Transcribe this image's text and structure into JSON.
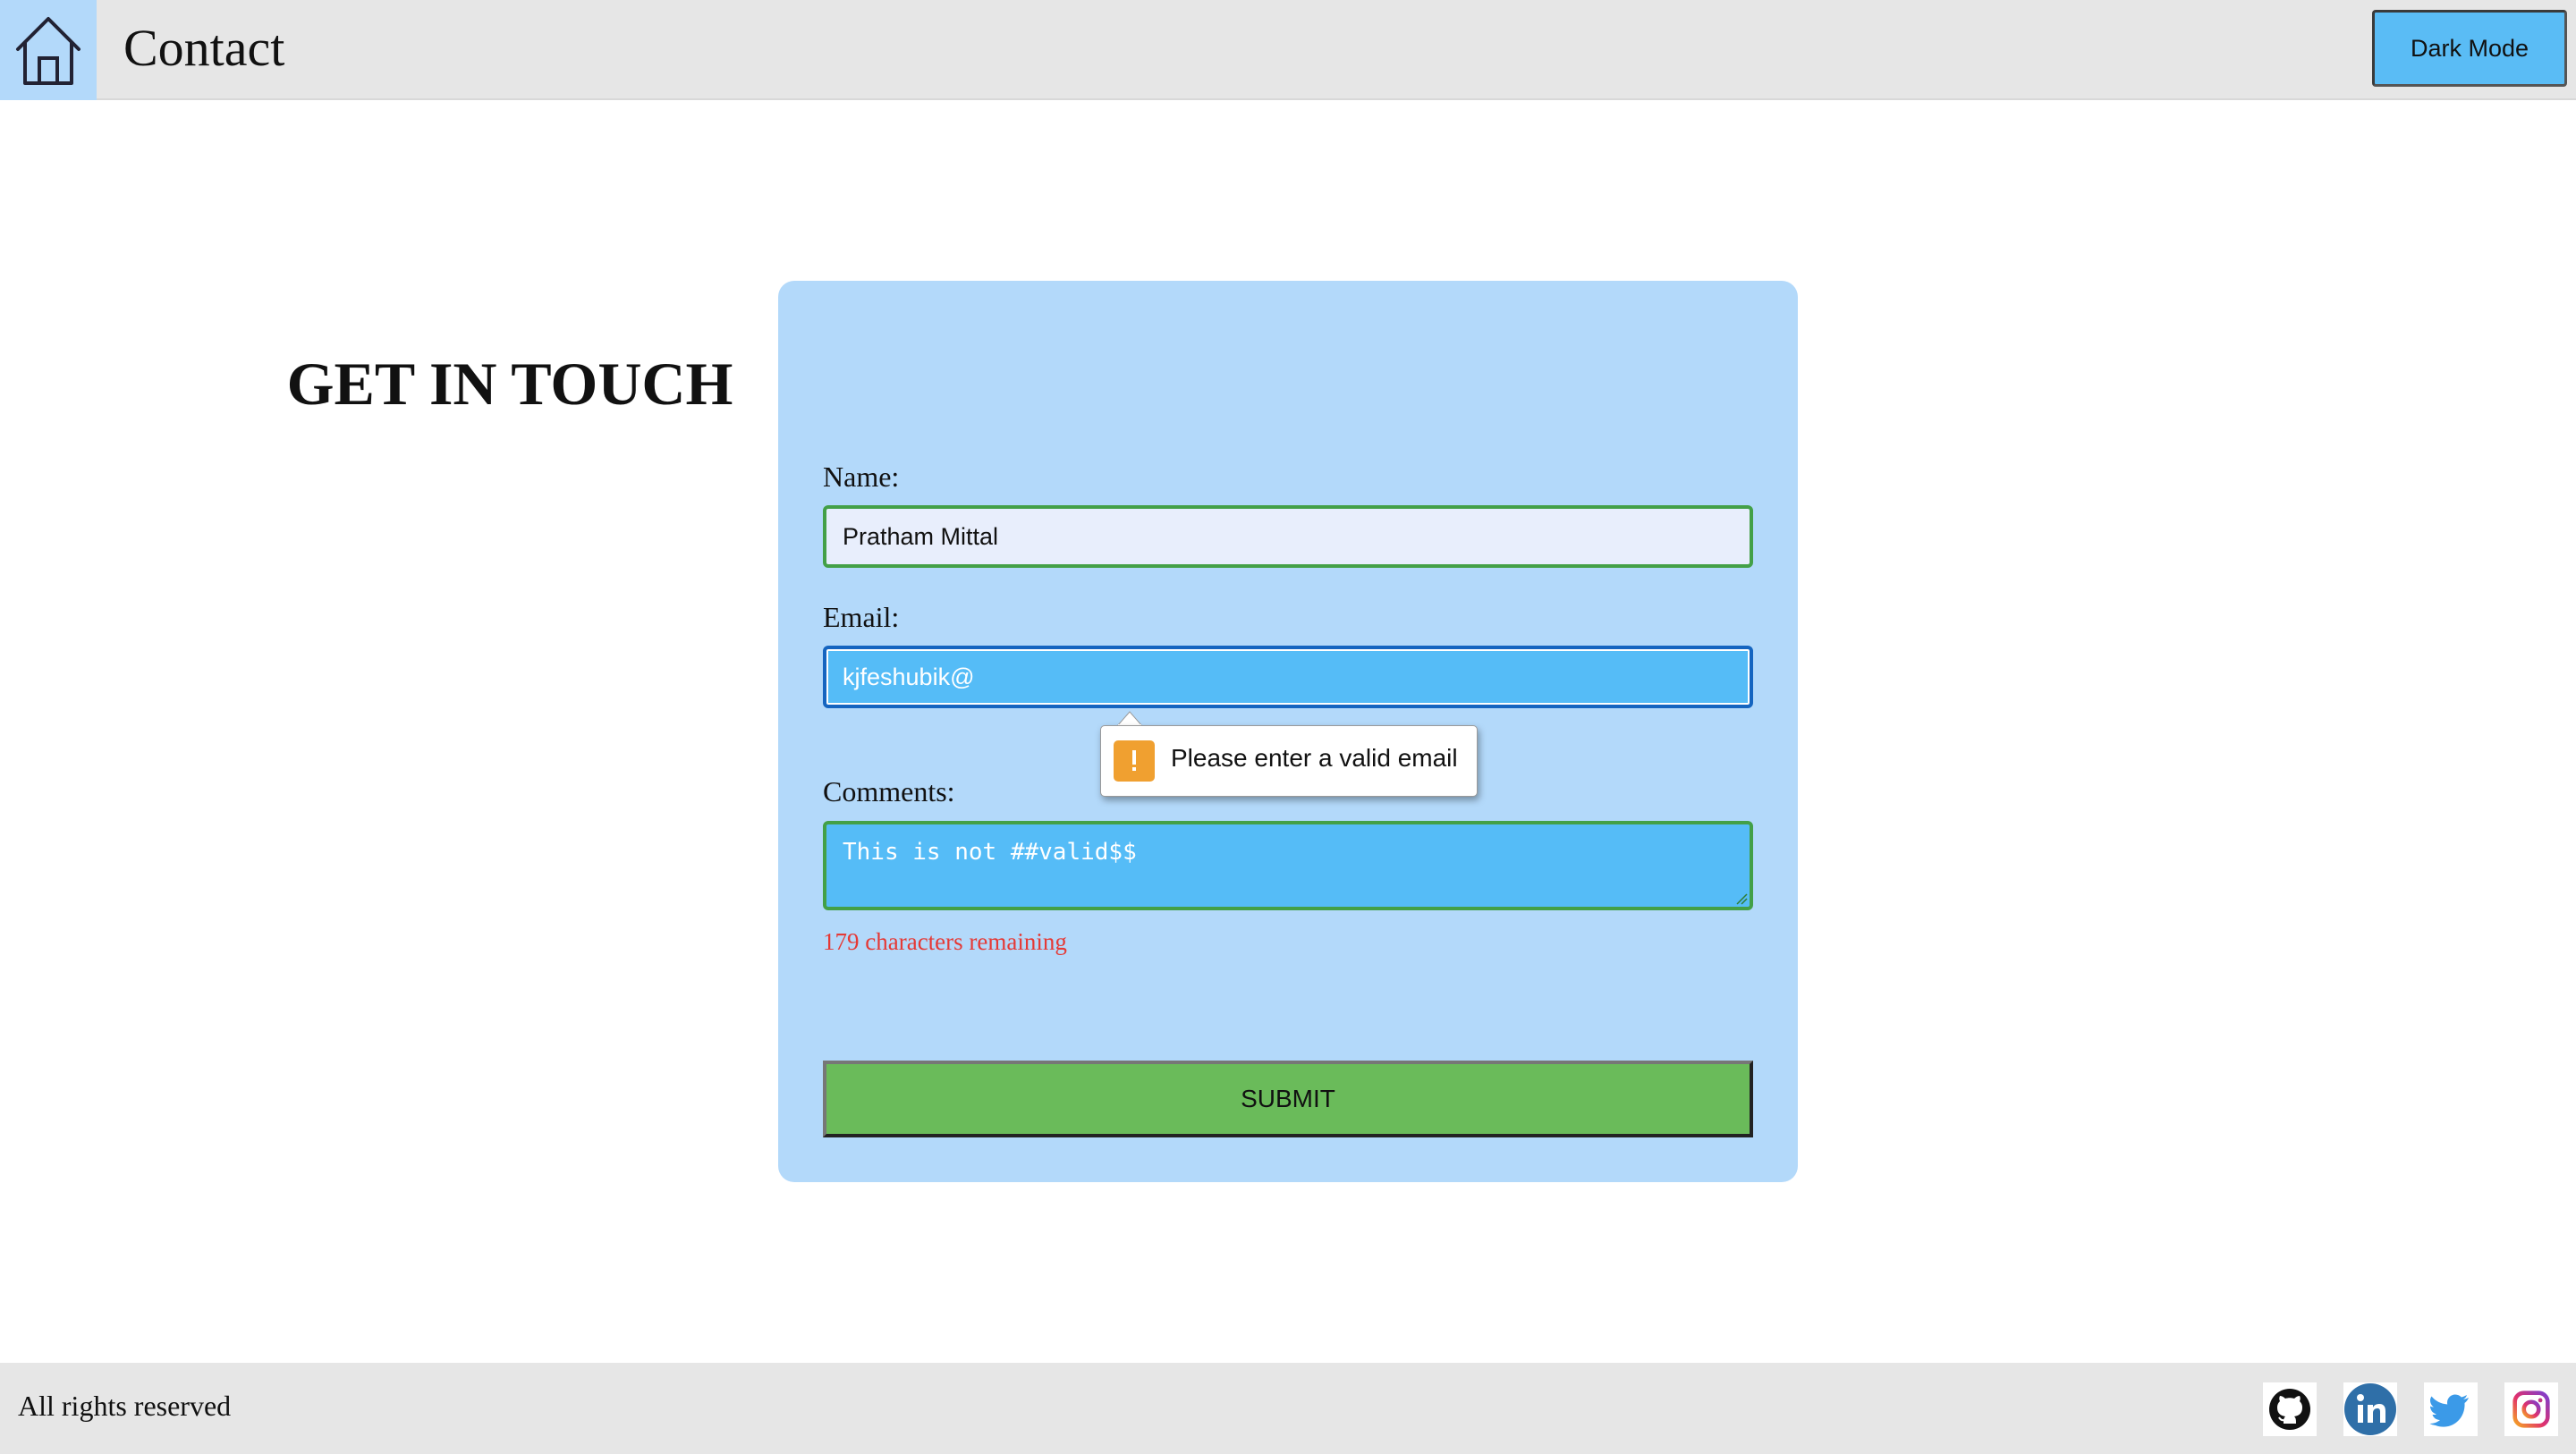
{
  "header": {
    "title": "Contact",
    "home_icon": "home-icon",
    "dark_mode_label": "Dark Mode"
  },
  "form": {
    "heading": "GET IN TOUCH",
    "name_label": "Name:",
    "name_value": "Pratham Mittal",
    "email_label": "Email:",
    "email_value": "kjfeshubik@",
    "comments_label": "Comments:",
    "comments_value": "This is not ##valid$$",
    "remaining_text": "179 characters remaining",
    "submit_label": "SUBMIT"
  },
  "validation": {
    "message": "Please enter a valid email",
    "icon": "warning-icon"
  },
  "footer": {
    "text": "All rights reserved",
    "social": [
      "github-icon",
      "linkedin-icon",
      "twitter-icon",
      "instagram-icon"
    ]
  },
  "colors": {
    "header_bg": "#e6e6e6",
    "card_bg": "#b3d9fa",
    "input_active_bg": "#55bcf7",
    "valid_border": "#43a047",
    "submit_bg": "#6abb5a",
    "error_text": "#e53935",
    "warning": "#f0a030"
  }
}
